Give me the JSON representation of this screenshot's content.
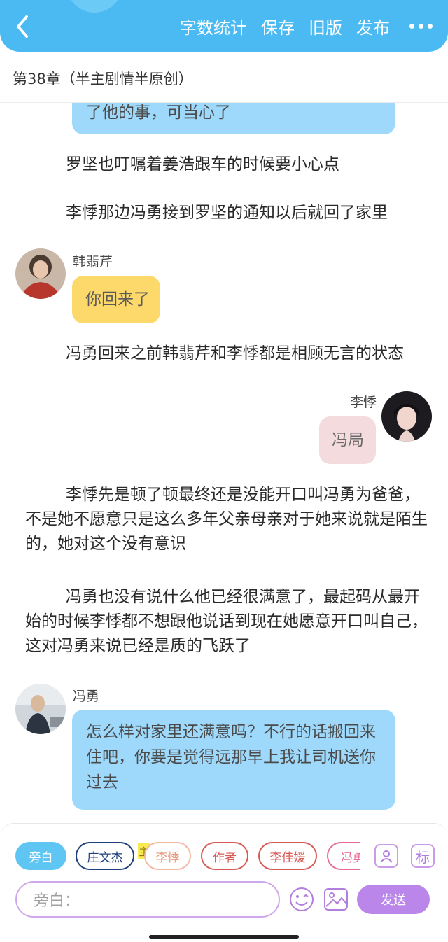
{
  "header": {
    "actions": [
      "字数统计",
      "保存",
      "旧版",
      "发布"
    ],
    "colors": {
      "bar": "#4bb9f2"
    }
  },
  "chapter_title": "第38章（半主剧情半原创）",
  "messages": {
    "partial_bubble": "了他的事，可当心了",
    "narr1": "罗坚也叮嘱着姜浩跟车的时候要小心点",
    "narr2": "李悸那边冯勇接到罗坚的通知以后就回了家里",
    "msg1": {
      "speaker": "韩翡芹",
      "text": "你回来了"
    },
    "narr3": "冯勇回来之前韩翡芹和李悸都是相顾无言的状态",
    "msg2": {
      "speaker": "李悸",
      "text": "冯局"
    },
    "narr4": [
      "李悸先是顿了顿最终还是没能开口叫冯勇为爸爸，",
      "不是她不愿意只是这么多年父亲母亲对于她来说就是陌生",
      "的，她对这个没有意识"
    ],
    "narr5": [
      "冯勇也没有说什么他已经很满意了，最起码从最开",
      "始的时候李悸都不想跟他说话到现在她愿意开口叫自己，",
      "这对冯勇来说已经是质的飞跃了"
    ],
    "msg3": {
      "speaker": "冯勇",
      "text": [
        "怎么样对家里还满意吗？不行的话搬回来",
        "住吧，你要是觉得远那早上我让司机送你",
        "过去"
      ]
    }
  },
  "composer": {
    "chips": [
      "旁白",
      "庄文杰",
      "李悸",
      "作者",
      "李佳媛",
      "冯勇"
    ],
    "main_tag": "主",
    "tag_button": "标",
    "input_placeholder": "旁白：",
    "send_label": "发送",
    "icons": [
      "person-icon",
      "emoji-icon",
      "image-icon"
    ]
  }
}
